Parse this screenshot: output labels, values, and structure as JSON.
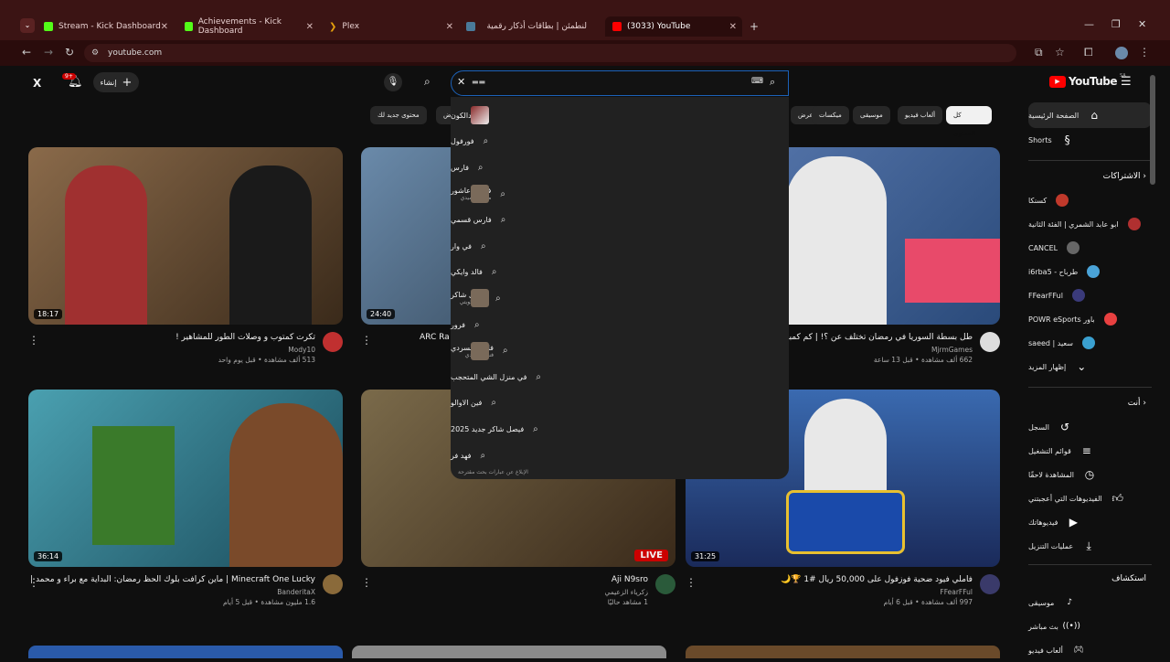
{
  "browser": {
    "tabs": [
      {
        "label": "Stream - Kick Dashboard",
        "color": "#53fc18"
      },
      {
        "label": "Achievements - Kick Dashboard",
        "color": "#53fc18"
      },
      {
        "label": "Plex",
        "color": "#e5a00d"
      },
      {
        "label": "لنطمئن | بطاقات أذكار رقمية",
        "color": "#4a7a9a"
      },
      {
        "label": "(3033) YouTube",
        "color": "#ff0000"
      }
    ],
    "url": "youtube.com"
  },
  "yt": {
    "create_label": "إنشاء",
    "notif_count": "9+",
    "logo": "YouTube",
    "logo_region": "SA",
    "search_value": "▬▬"
  },
  "chips": [
    "كل المحتوى",
    "ألعاب فيديو",
    "موسيقى",
    "ميكسات",
    "عرض",
    "عرض",
    "محتوى جديد لك"
  ],
  "sidebar": {
    "home": "الصفحة الرئيسية",
    "shorts": "Shorts",
    "subs_head": "الاشتراكات",
    "subs": [
      {
        "name": "كسنكا",
        "color": "#c0392b"
      },
      {
        "name": "ابو عابد الشمري | الفئة الثانية",
        "color": "#b03030"
      },
      {
        "name": "CANCEL",
        "color": "#666"
      },
      {
        "name": "طرباح - i6rba5",
        "color": "#4aa3d8"
      },
      {
        "name": "FFearFFul",
        "color": "#3a3a7a"
      },
      {
        "name": "باور POWR eSports",
        "color": "#e84040"
      },
      {
        "name": "سعيد | saeed",
        "color": "#3aa0d0"
      }
    ],
    "show_more": "إظهار المزيد",
    "you_head": "أنت",
    "you": [
      "السجل",
      "قوائم التشغيل",
      "المشاهدة لاحقًا",
      "الفيديوهات التي أعجبتني",
      "فيديوهاتك",
      "عمليات التنزيل"
    ],
    "explore_head": "استكشاف",
    "explore": [
      "موسيقى",
      "بث مباشر",
      "ألعاب فيديو"
    ]
  },
  "dropdown": {
    "suggestions": [
      {
        "text": "دالكون",
        "sub": "",
        "thumb": true
      },
      {
        "text": "فورفول",
        "sub": "",
        "thumb": false
      },
      {
        "text": "فارس",
        "sub": "",
        "thumb": false
      },
      {
        "text": "فارس عاشور",
        "sub": "ممثل كوميدي",
        "thumb": true
      },
      {
        "text": "فارس قسمي",
        "sub": "",
        "thumb": false
      },
      {
        "text": "في وار",
        "sub": "",
        "thumb": false
      },
      {
        "text": "فالد وايكي",
        "sub": "",
        "thumb": false
      },
      {
        "text": "فيصل شاكر",
        "sub": "ممثل كويتي",
        "thumb": true
      },
      {
        "text": "فرور",
        "sub": "",
        "thumb": false
      },
      {
        "text": "فلاح المسردي",
        "sub": "فنان سعودي",
        "thumb": true
      },
      {
        "text": "في منزل الشي المتحجب",
        "sub": "",
        "thumb": false
      },
      {
        "text": "فين الاوالو",
        "sub": "",
        "thumb": false
      },
      {
        "text": "فيصل شاكر جديد 2025",
        "sub": "",
        "thumb": false
      },
      {
        "text": "فهد فر",
        "sub": "",
        "thumb": false
      }
    ],
    "report": "الإبلاغ عن عبارات بحث مقترحة"
  },
  "videos": [
    {
      "title": "تكرت كمتوب و وصلات الطور للمشاهير !",
      "channel": "Mody10",
      "meta": "513 ألف مشاهدة • قبل يوم واحد",
      "duration": "18:17",
      "bg": "#7a5a3a",
      "avatar": "#c03030"
    },
    {
      "title": "ARC Ra",
      "channel": "",
      "meta": "",
      "duration": "24:40",
      "bg": "#3a4a6a",
      "avatar": "#555"
    },
    {
      "title": "طل بسطة السوريا في رمضان تختلف عن ؟! | كم كمبدا في",
      "channel": "MjrmGames",
      "meta": "662 ألف مشاهدة • قبل 13 ساعة",
      "duration": "",
      "bg": "#4a6aa0",
      "avatar": "#ddd"
    },
    {
      "title": "Minecraft One Lucky | ماين كرافت بلوك الحظ رمضان: البداية مع براء و محمد | Block #1",
      "channel": "BanderitaX",
      "meta": "1.6 مليون مشاهدة • قبل 5 أيام",
      "duration": "36:14",
      "bg": "#3a8a8a",
      "avatar": "#8a6a3a"
    },
    {
      "title": "Aji N9sro",
      "channel": "زكرياء الزعيمي",
      "meta": "1 مشاهد حاليًا",
      "duration": "LIVE",
      "bg": "#6a5a3a",
      "avatar": "#2a5a3a"
    },
    {
      "title": "فاملي فيود ضحية فوزفول على 50,000 ريال #1 🏆🌙",
      "channel": "FFearFFul",
      "meta": "997 ألف مشاهدة • قبل 6 أيام",
      "duration": "31:25",
      "bg": "#2a4a8a",
      "avatar": "#3a3a6a"
    }
  ]
}
